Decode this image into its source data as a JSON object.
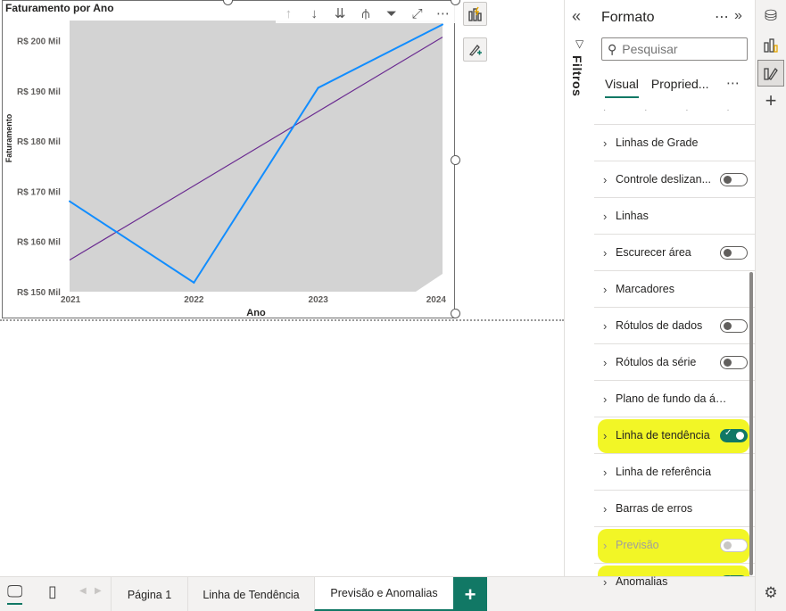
{
  "visual": {
    "title": "Faturamento por Ano",
    "toolbar_icons": [
      "arrow-up-icon",
      "arrow-down-icon",
      "double-arrow-down-icon",
      "expand-hierarchy-icon",
      "filter-icon",
      "focus-mode-icon",
      "more-options-icon"
    ]
  },
  "chart_data": {
    "type": "line",
    "x": [
      "2021",
      "2022",
      "2023",
      "2024"
    ],
    "xlabel": "Ano",
    "ylabel": "Faturamento",
    "ylim": [
      150,
      204
    ],
    "yticks": [
      150,
      160,
      170,
      180,
      190,
      200
    ],
    "ytick_labels": [
      "R$ 150 Mil",
      "R$ 160 Mil",
      "R$ 170 Mil",
      "R$ 180 Mil",
      "R$ 190 Mil",
      "R$ 200 Mil"
    ],
    "background": "#d3d3d3",
    "series": [
      {
        "values": [
          168.0,
          151.8,
          190.6,
          203.2
        ],
        "color": "#118dff"
      }
    ],
    "trendline": {
      "values": [
        156.3,
        171.1,
        185.9,
        200.7
      ],
      "color": "#6b2c91"
    }
  },
  "filters": {
    "label": "Filtros"
  },
  "format_pane": {
    "title": "Formato",
    "search_placeholder": "Pesquisar",
    "tabs": [
      "Visual",
      "Propried..."
    ],
    "sections": [
      {
        "label": "Linhas de Grade",
        "toggle": null
      },
      {
        "label": "Controle deslizan...",
        "toggle": "off"
      },
      {
        "label": "Linhas",
        "toggle": null
      },
      {
        "label": "Escurecer área",
        "toggle": "off"
      },
      {
        "label": "Marcadores",
        "toggle": null
      },
      {
        "label": "Rótulos de dados",
        "toggle": "off"
      },
      {
        "label": "Rótulos da série",
        "toggle": "off"
      },
      {
        "label": "Plano de fundo da área ...",
        "toggle": null
      },
      {
        "label": "Linha de tendência",
        "toggle": "on",
        "highlighted": true
      },
      {
        "label": "Linha de referência",
        "toggle": null
      },
      {
        "label": "Barras de erros",
        "toggle": null
      },
      {
        "label": "Previsão",
        "toggle": "disabled",
        "highlighted": true,
        "disabled": true
      },
      {
        "label": "Anomalias",
        "toggle": "on",
        "highlighted": true
      }
    ]
  },
  "pages": {
    "tabs": [
      "Página 1",
      "Linha de Tendência",
      "Previsão e Anomalias"
    ],
    "active": 2,
    "add_label": "+"
  },
  "colors": {
    "accent": "#117865",
    "highlight": "#f0f500"
  }
}
